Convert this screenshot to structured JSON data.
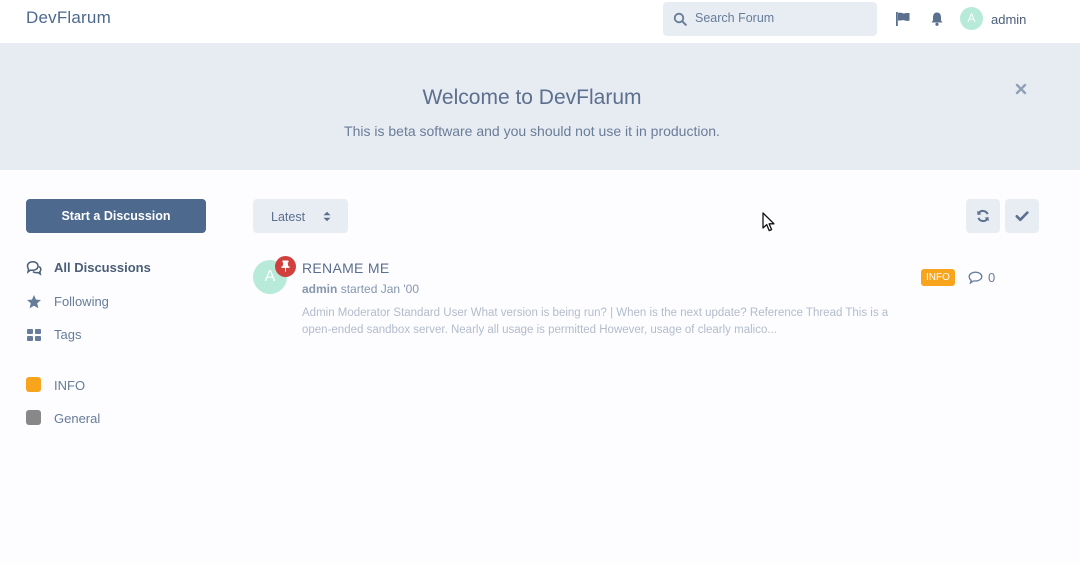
{
  "header": {
    "brand": "DevFlarum",
    "search_placeholder": "Search Forum",
    "avatar_letter": "A",
    "username": "admin"
  },
  "hero": {
    "title": "Welcome to DevFlarum",
    "subtitle": "This is beta software and you should not use it in production."
  },
  "sidebar": {
    "start_button": "Start a Discussion",
    "nav": [
      {
        "label": "All Discussions",
        "icon": "comments-icon",
        "active": true
      },
      {
        "label": "Following",
        "icon": "star-icon",
        "active": false
      },
      {
        "label": "Tags",
        "icon": "tags-grid-icon",
        "active": false
      }
    ],
    "tags": [
      {
        "label": "INFO",
        "color": "#f8a41d"
      },
      {
        "label": "General",
        "color": "#888888"
      }
    ]
  },
  "toolbar": {
    "sort_label": "Latest"
  },
  "discussion": {
    "avatar_letter": "A",
    "title": "RENAME ME",
    "author": "admin",
    "started": "started Jan '00",
    "excerpt": "Admin Moderator Standard User What version is being run? | When is the next update? Reference Thread This is a open-ended sandbox server. Nearly all usage is permitted However, usage of clearly malico...",
    "tag": "INFO",
    "tag_color": "#f8a41d",
    "replies": "0"
  },
  "colors": {
    "primary": "#4d698e",
    "hero_bg": "#e7ebf2",
    "pin": "#d0403d"
  }
}
